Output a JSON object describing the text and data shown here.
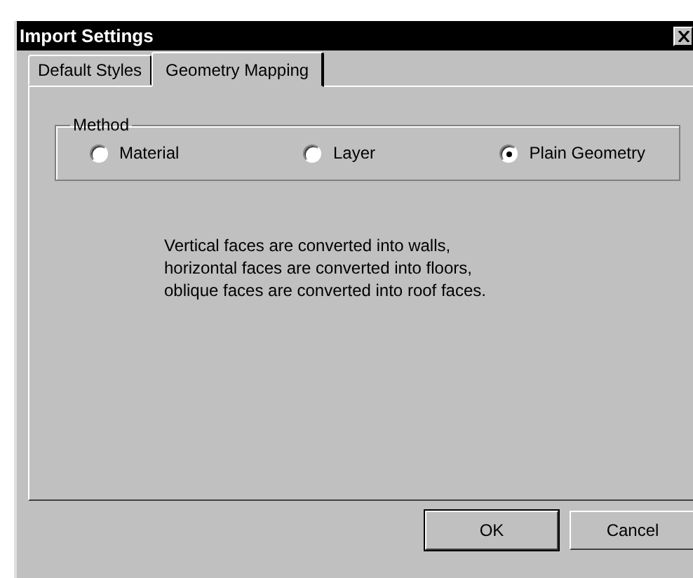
{
  "window": {
    "title": "Import Settings"
  },
  "tabs": [
    {
      "label": "Default Styles",
      "selected": false
    },
    {
      "label": "Geometry Mapping",
      "selected": true
    }
  ],
  "method": {
    "legend": "Method",
    "options": [
      {
        "label": "Material",
        "selected": false
      },
      {
        "label": "Layer",
        "selected": false
      },
      {
        "label": "Plain Geometry",
        "selected": true
      }
    ]
  },
  "description": [
    "Vertical faces are converted into walls,",
    "horizontal faces are converted into floors,",
    "oblique faces are converted into roof faces."
  ],
  "buttons": [
    {
      "label": "OK",
      "default": true
    },
    {
      "label": "Cancel",
      "default": false
    }
  ]
}
